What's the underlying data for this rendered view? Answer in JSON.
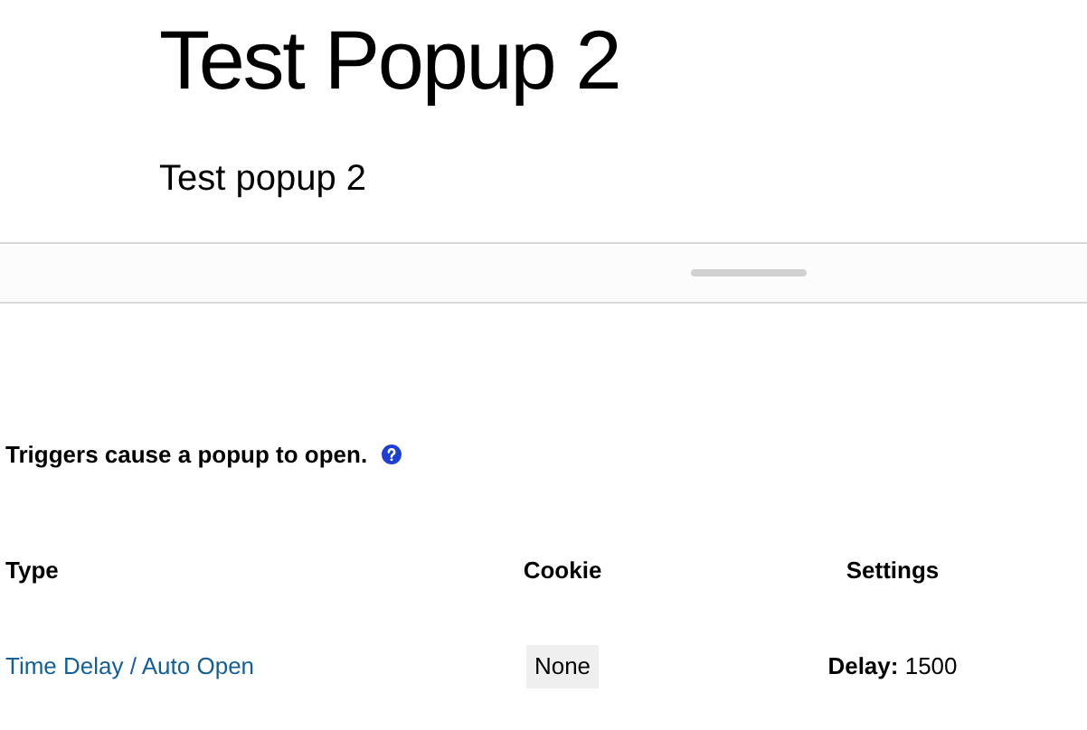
{
  "title": "Test Popup 2",
  "subtitle": "Test popup 2",
  "triggers_help": "Triggers cause a popup to open.",
  "table": {
    "columns": [
      "Type",
      "Cookie",
      "Settings"
    ],
    "rows": [
      {
        "type": "Time Delay / Auto Open",
        "cookie": "None",
        "settings": "**Delay:** 1500"
      }
    ]
  }
}
